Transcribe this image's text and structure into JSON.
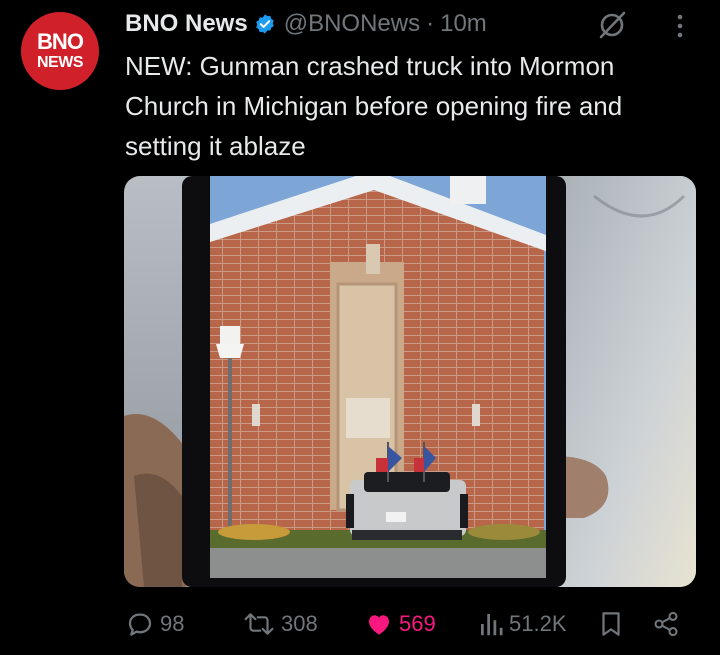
{
  "account": {
    "avatar_line1": "BNO",
    "avatar_line2": "NEWS",
    "name": "BNO News",
    "handle": "@BNONews",
    "separator": "·",
    "time": "10m"
  },
  "tweet": {
    "text": "NEW: Gunman crashed truck into Mormon Church in Michigan before opening fire and setting it ablaze"
  },
  "metrics": {
    "replies": "98",
    "retweets": "308",
    "likes": "569",
    "views": "51.2K"
  },
  "colors": {
    "background": "#000000",
    "brand_red": "#d0202a",
    "verified_blue": "#1d9bf0",
    "muted": "#71767b",
    "like_pink": "#f91880"
  },
  "icons": [
    "verified-icon",
    "grok-icon",
    "more-icon",
    "reply-icon",
    "retweet-icon",
    "like-icon",
    "views-icon",
    "bookmark-icon",
    "share-icon"
  ]
}
